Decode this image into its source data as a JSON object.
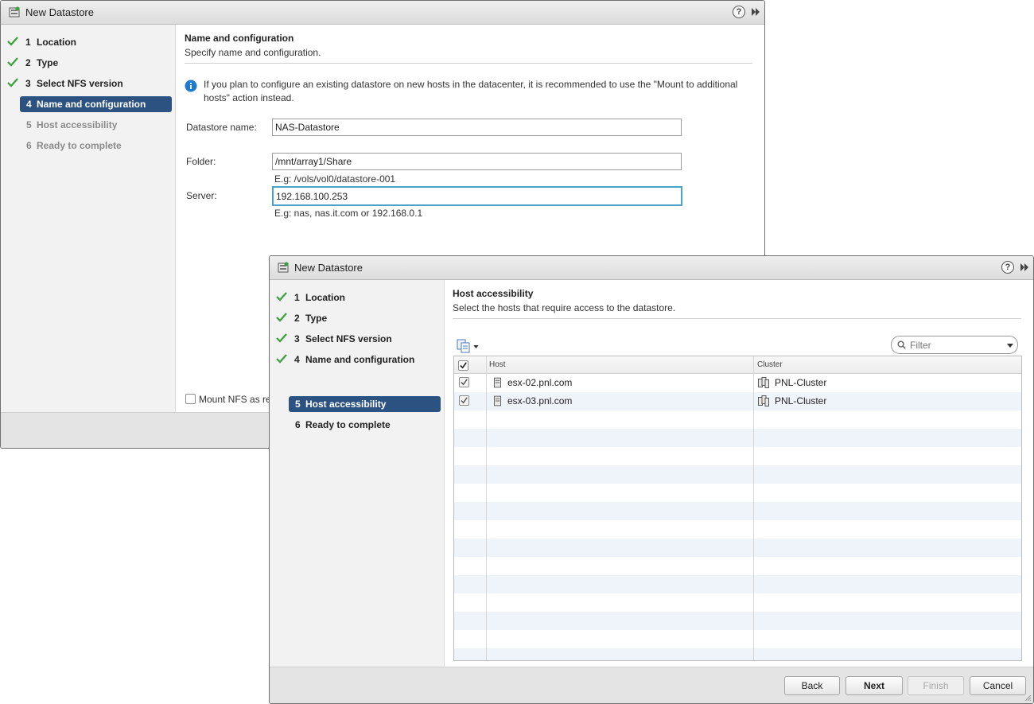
{
  "back_dialog": {
    "title": "New Datastore",
    "steps": [
      {
        "num": "1",
        "label": "Location",
        "state": "done"
      },
      {
        "num": "2",
        "label": "Type",
        "state": "done"
      },
      {
        "num": "3",
        "label": "Select NFS version",
        "state": "done"
      },
      {
        "num": "4",
        "label": "Name and configuration",
        "state": "active"
      },
      {
        "num": "5",
        "label": "Host accessibility",
        "state": "pending"
      },
      {
        "num": "6",
        "label": "Ready to complete",
        "state": "pending"
      }
    ],
    "header_title": "Name and configuration",
    "header_subtitle": "Specify name and configuration.",
    "info_line1": "If you plan to configure an existing datastore on new hosts in the datacenter, it is recommended to use the \"Mount to additional",
    "info_line2": "hosts\" action instead.",
    "datastore_name_label": "Datastore name:",
    "datastore_name_value": "NAS-Datastore",
    "folder_label": "Folder:",
    "folder_value": "/mnt/array1/Share",
    "folder_hint": "E.g: /vols/vol0/datastore-001",
    "server_label": "Server:",
    "server_value": "192.168.100.253",
    "server_hint": "E.g: nas, nas.it.com or 192.168.0.1",
    "mount_readonly_partial": "Mount NFS as re"
  },
  "front_dialog": {
    "title": "New Datastore",
    "steps": [
      {
        "num": "1",
        "label": "Location",
        "state": "done"
      },
      {
        "num": "2",
        "label": "Type",
        "state": "done"
      },
      {
        "num": "3",
        "label": "Select NFS version",
        "state": "done"
      },
      {
        "num": "4",
        "label": "Name and configuration",
        "state": "done"
      },
      {
        "num": "5",
        "label": "Host accessibility",
        "state": "active"
      },
      {
        "num": "6",
        "label": "Ready to complete",
        "state": "pending"
      }
    ],
    "header_title": "Host accessibility",
    "header_subtitle": "Select the hosts that require access to the datastore.",
    "filter_placeholder": "Filter",
    "columns": {
      "host": "Host",
      "cluster": "Cluster"
    },
    "rows": [
      {
        "host": "esx-02.pnl.com",
        "cluster": "PNL-Cluster",
        "checked": true
      },
      {
        "host": "esx-03.pnl.com",
        "cluster": "PNL-Cluster",
        "checked": true
      }
    ],
    "buttons": {
      "back": "Back",
      "next": "Next",
      "finish": "Finish",
      "cancel": "Cancel"
    }
  },
  "colors": {
    "accent": "#2c5282",
    "check": "#3aa13a",
    "focus": "#4aa3c8",
    "info": "#1d7bd6"
  }
}
